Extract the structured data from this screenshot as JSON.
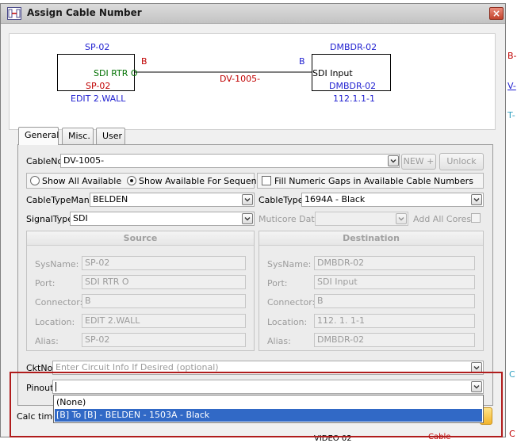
{
  "background": {
    "right_fragments": [
      "B-",
      "V-",
      "T-",
      "C",
      "C"
    ],
    "bottom_fragments": [
      "VIDEO 02",
      "Cable"
    ]
  },
  "dialog": {
    "title": "Assign Cable Number",
    "close_label": "×"
  },
  "diagram": {
    "source": {
      "sysname_top": "SP-02",
      "port": "SDI RTR O",
      "sysname_inner": "SP-02",
      "location": "EDIT 2.WALL",
      "connector": "B"
    },
    "destination": {
      "sysname_top": "DMBDR-02",
      "port": "SDI Input",
      "sysname_inner": "DMBDR-02",
      "location": "112.1.1-1",
      "connector": "B"
    },
    "cable_label": "DV-1005-"
  },
  "tabs": [
    {
      "label": "General",
      "active": true
    },
    {
      "label": "Misc.",
      "active": false
    },
    {
      "label": "User",
      "active": false
    }
  ],
  "form": {
    "cableno_label": "CableNo",
    "cableno_value": "DV-1005-",
    "new_label": "NEW",
    "unlock_label": "Unlock",
    "radio_show_all": "Show All Available",
    "radio_show_seq": "Show Available For Sequence",
    "fill_gaps_label": "Fill Numeric Gaps in Available Cable Numbers",
    "cabletypemanu_label": "CableTypeManu",
    "cabletypemanu_value": "BELDEN",
    "cabletype_label": "CableType",
    "cabletype_value": "1694A - Black",
    "signaltype_label": "SignalType",
    "signaltype_value": "SDI",
    "multicore_label": "Muticore Data",
    "add_all_cores_label": "Add All Cores",
    "source": {
      "header": "Source",
      "rows": [
        {
          "label": "SysName:",
          "value": "SP-02"
        },
        {
          "label": "Port:",
          "value": "SDI RTR O"
        },
        {
          "label": "Connector:",
          "value": "B"
        },
        {
          "label": "Location:",
          "value": "EDIT 2.WALL"
        },
        {
          "label": "Alias:",
          "value": "SP-02"
        }
      ]
    },
    "destination": {
      "header": "Destination",
      "rows": [
        {
          "label": "SysName:",
          "value": "DMBDR-02"
        },
        {
          "label": "Port:",
          "value": "SDI Input"
        },
        {
          "label": "Connector:",
          "value": "B"
        },
        {
          "label": "Location:",
          "value": "112. 1. 1-1"
        },
        {
          "label": "Alias:",
          "value": "DMBDR-02"
        }
      ]
    },
    "cktno_label": "CktNo",
    "cktno_placeholder": "Enter Circuit Info If Desired (optional)",
    "pinout_label": "Pinout",
    "pinout_value": "",
    "pinout_options": [
      "(None)",
      "[B] To [B] - BELDEN - 1503A - Black"
    ],
    "calc_time_label": "Calc time="
  }
}
